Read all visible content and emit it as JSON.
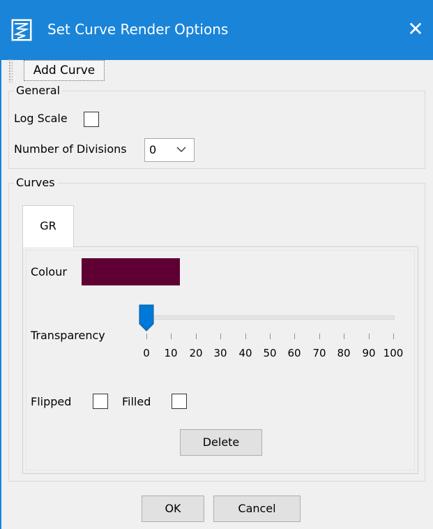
{
  "window": {
    "title": "Set Curve Render Options",
    "close_icon": "close-icon",
    "app_icon": "curve-chart-icon",
    "accent": "#1a84d9"
  },
  "toolbar": {
    "add_curve_label": "Add Curve"
  },
  "general": {
    "legend": "General",
    "log_scale_label": "Log Scale",
    "log_scale_checked": false,
    "divisions_label": "Number of Divisions",
    "divisions_value": "0"
  },
  "curves": {
    "legend": "Curves",
    "tabs": [
      {
        "label": "GR",
        "selected": true
      }
    ],
    "colour_label": "Colour",
    "colour_value": "#5e0033",
    "transparency_label": "Transparency",
    "transparency_value": 0,
    "transparency_ticks": [
      "0",
      "10",
      "20",
      "30",
      "40",
      "50",
      "60",
      "70",
      "80",
      "90",
      "100"
    ],
    "flipped_label": "Flipped",
    "flipped_checked": false,
    "filled_label": "Filled",
    "filled_checked": false,
    "delete_label": "Delete"
  },
  "footer": {
    "ok_label": "OK",
    "cancel_label": "Cancel"
  }
}
